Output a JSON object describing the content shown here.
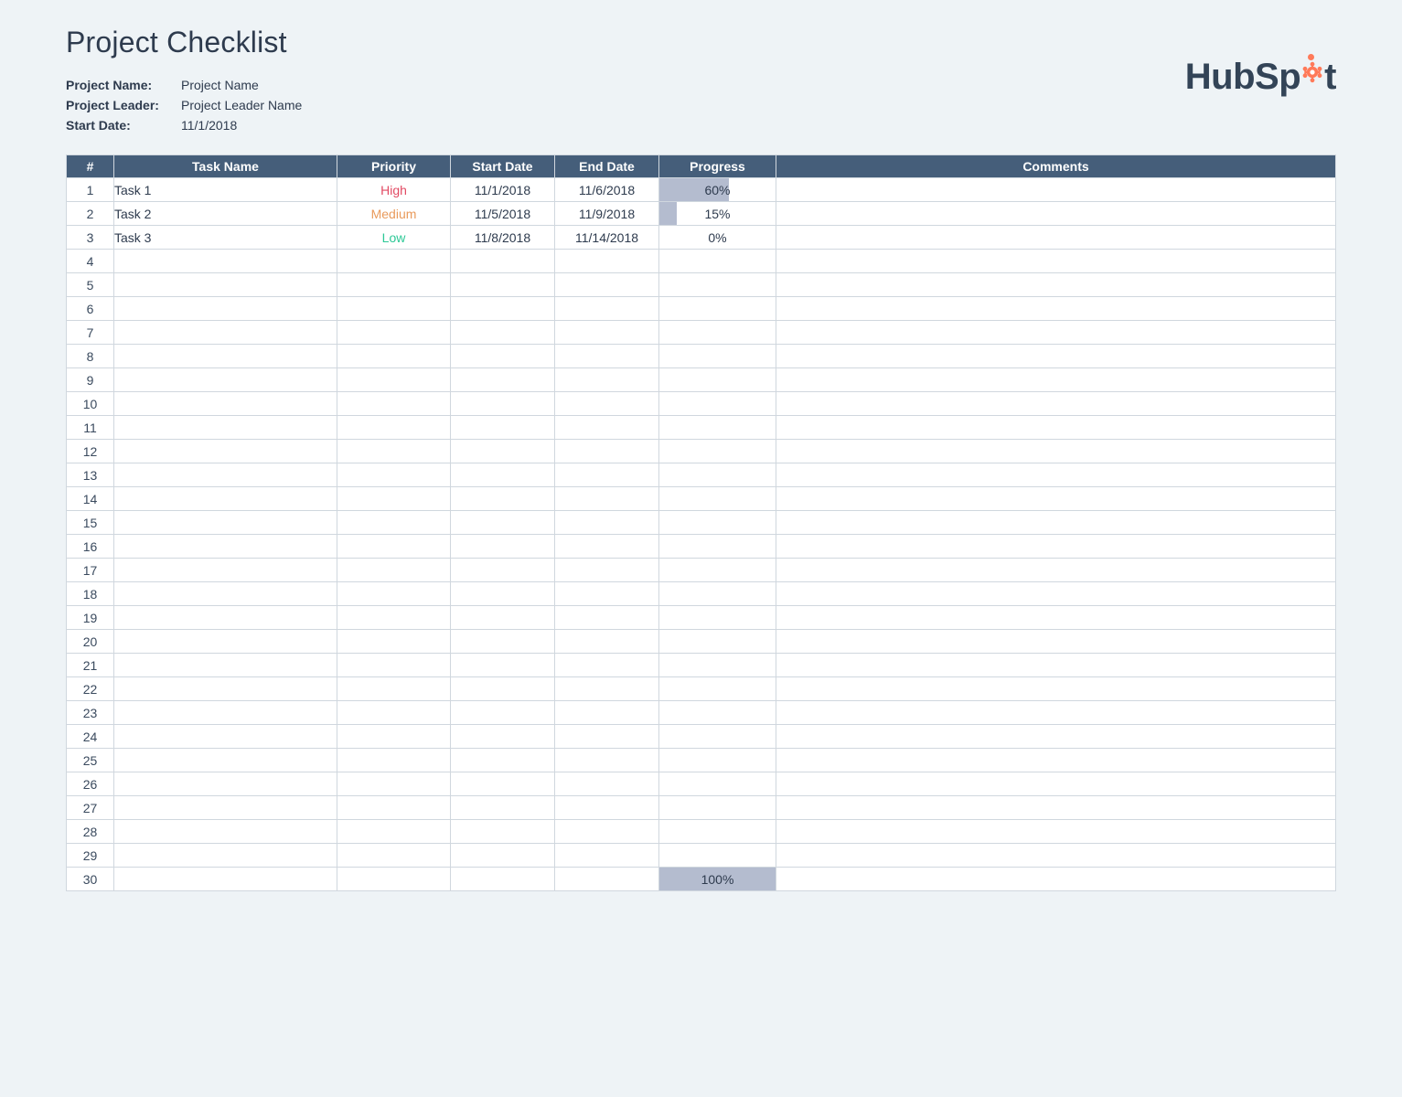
{
  "title": "Project Checklist",
  "meta": {
    "name_label": "Project Name:",
    "name_value": "Project Name",
    "leader_label": "Project Leader:",
    "leader_value": "Project Leader Name",
    "startdate_label": "Start Date:",
    "startdate_value": "11/1/2018"
  },
  "logo": {
    "text_left": "HubSp",
    "text_right": "t"
  },
  "columns": {
    "num": "#",
    "task": "Task Name",
    "priority": "Priority",
    "start": "Start Date",
    "end": "End Date",
    "progress": "Progress",
    "comments": "Comments"
  },
  "priority_colors": {
    "High": "prio-high",
    "Medium": "prio-medium",
    "Low": "prio-low"
  },
  "total_rows": 30,
  "rows": [
    {
      "task": "Task 1",
      "priority": "High",
      "start": "11/1/2018",
      "end": "11/6/2018",
      "progress": 60,
      "progress_label": "60%",
      "comments": ""
    },
    {
      "task": "Task 2",
      "priority": "Medium",
      "start": "11/5/2018",
      "end": "11/9/2018",
      "progress": 15,
      "progress_label": "15%",
      "comments": ""
    },
    {
      "task": "Task 3",
      "priority": "Low",
      "start": "11/8/2018",
      "end": "11/14/2018",
      "progress": 0,
      "progress_label": "0%",
      "comments": ""
    }
  ],
  "footer_row_index": 30,
  "footer_progress": {
    "value": 100,
    "label": "100%"
  }
}
